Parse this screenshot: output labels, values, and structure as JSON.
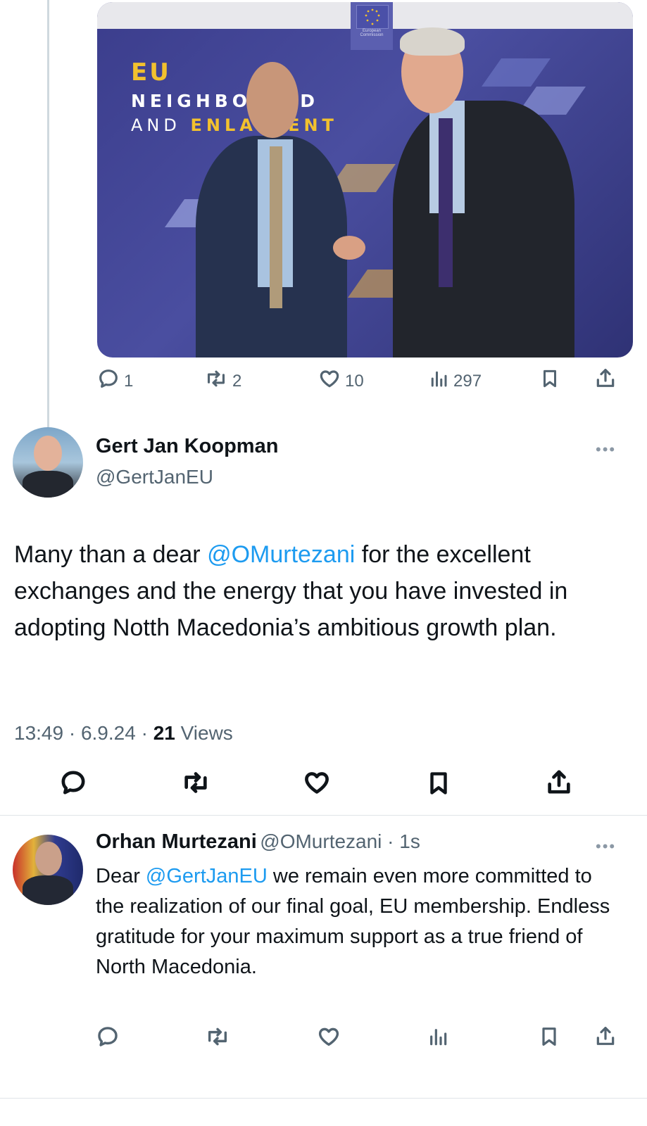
{
  "photo": {
    "banner_line1": "EU",
    "banner_line2": "NEIGHBO   OOD",
    "banner_line3a": "AND ",
    "banner_line3b": "ENLA   MENT",
    "ec_label": "European Commission"
  },
  "top_actions": {
    "replies": "1",
    "reposts": "2",
    "likes": "10",
    "views": "297"
  },
  "main_tweet": {
    "author_name": "Gert Jan Koopman",
    "author_handle": "@GertJanEU",
    "more": "•••",
    "text_part1": "Many than a dear ",
    "mention": "@OMurtezani",
    "text_part2": " for the excellent exchanges and the energy that you have invested in adopting Notth Macedonia’s ambitious growth plan.",
    "time": "13:49 · 6.9.24 · ",
    "views_count": "21",
    "views_label": " Views"
  },
  "reply_tweet": {
    "author_name": "Orhan Murtezani",
    "author_handle": "@OMurtezani",
    "time": " · 1s",
    "more": "•••",
    "text_part1": "Dear ",
    "mention": "@GertJanEU",
    "text_part2": " we remain even more committed to the realization of our final goal, EU membership. Endless gratitude for your maximum support as a true friend of North Macedonia."
  },
  "colors": {
    "accent": "#1d9bf0",
    "secondary_text": "#536471",
    "divider": "#dfe4e8"
  }
}
